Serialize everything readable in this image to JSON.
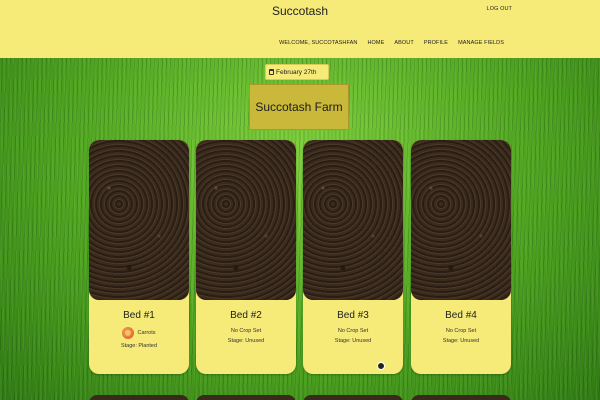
{
  "header": {
    "brand": "Succotash",
    "logout": "LOG OUT",
    "nav": [
      "WELCOME, SUCCOTASHFAN",
      "HOME",
      "ABOUT",
      "PROFILE",
      "MANAGE FIELDS"
    ]
  },
  "date": {
    "label": "February 27th",
    "icon": "calendar-icon"
  },
  "farm": {
    "title": "Succotash Farm"
  },
  "beds": [
    {
      "name": "Bed #1",
      "crop": "Carrots",
      "crop_icon": "shrimp-icon",
      "stage": "Stage: Planted"
    },
    {
      "name": "Bed #2",
      "crop": "No Crop Set",
      "stage": "Stage: Unused"
    },
    {
      "name": "Bed #3",
      "crop": "No Crop Set",
      "stage": "Stage: Unused"
    },
    {
      "name": "Bed #4",
      "crop": "No Crop Set",
      "stage": "Stage: Unused"
    }
  ],
  "colors": {
    "nav_bg": "#f6ea78",
    "title_bg": "#c9b83a",
    "grass": "#4ea51e"
  }
}
